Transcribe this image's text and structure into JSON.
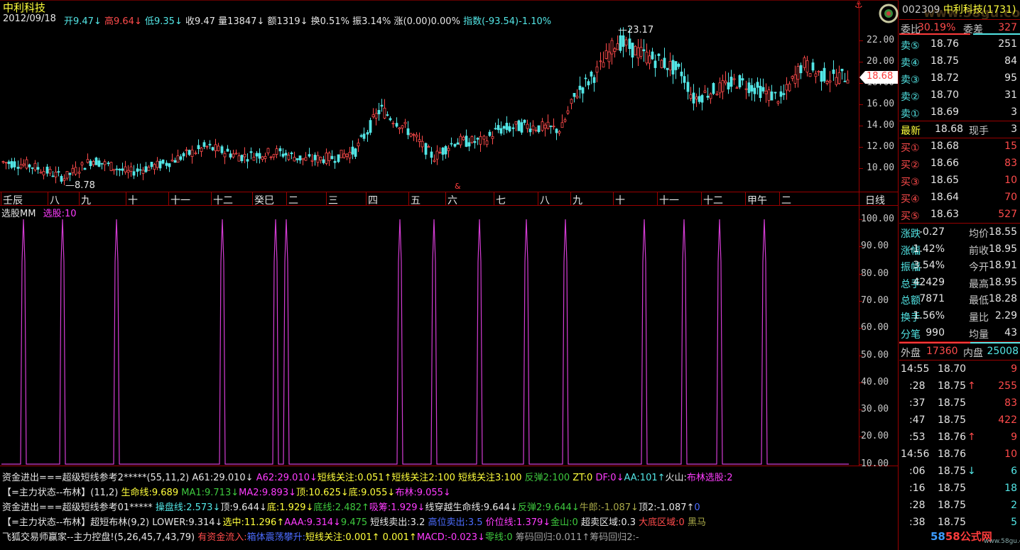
{
  "header": {
    "stock_name": "中利科技",
    "date": "2012/09/18",
    "items": [
      {
        "text": "开9.47",
        "color": "#53e6e6",
        "arrow": "↓",
        "arrow_color": "#53e6e6"
      },
      {
        "text": "高9.64",
        "color": "#ff4b4b",
        "arrow": "↓",
        "arrow_color": "#ff4b4b"
      },
      {
        "text": "低9.35",
        "color": "#53e6e6",
        "arrow": "↓",
        "arrow_color": "#53e6e6"
      },
      {
        "text": "收9.47",
        "color": "#e6e6e6",
        "arrow": "",
        "arrow_color": ""
      },
      {
        "text": "量13847",
        "color": "#e6e6e6",
        "arrow": "↓",
        "arrow_color": "#e6e6e6"
      },
      {
        "text": "额1319",
        "color": "#e6e6e6",
        "arrow": "↓",
        "arrow_color": "#e6e6e6"
      },
      {
        "text": "换0.51%",
        "color": "#e6e6e6",
        "arrow": "",
        "arrow_color": ""
      },
      {
        "text": "振3.14%",
        "color": "#e6e6e6",
        "arrow": "",
        "arrow_color": ""
      },
      {
        "text": "涨(0.00)0.00%",
        "color": "#e6e6e6",
        "arrow": "",
        "arrow_color": ""
      },
      {
        "text": "指数(-93.54)-1.10%",
        "color": "#53e6e6",
        "arrow": "",
        "arrow_color": ""
      }
    ]
  },
  "kline": {
    "high_label": "23.17",
    "low_label": "8.78",
    "price_axis": [
      "22.00",
      "20.00",
      "18.00",
      "16.00",
      "14.00",
      "12.00",
      "10.00"
    ],
    "current_price": "18.68",
    "month_labels": [
      "壬辰",
      "八",
      "九",
      "十",
      "十一",
      "十二",
      "癸巳",
      "二",
      "三",
      "四",
      "五",
      "六",
      "七",
      "八",
      "九",
      "十",
      "十一",
      "十二",
      "甲午",
      "二"
    ],
    "period": "日线",
    "marker": "&"
  },
  "indicator": {
    "name": "选股MM",
    "value_label": "选股:10",
    "axis": [
      "100.00",
      "90.00",
      "80.00",
      "70.00",
      "60.00",
      "50.00",
      "40.00",
      "30.00",
      "20.00",
      "10.00"
    ]
  },
  "formula_lines": [
    [
      {
        "t": "资金进出===超级短线参考2*****(55,11,2)",
        "c": "#e6e6e6"
      },
      {
        "t": " A61:29.010",
        "c": "#e6e6e6"
      },
      {
        "t": "↓",
        "c": "#e6e6e6"
      },
      {
        "t": " A62:29.010",
        "c": "#ff3cff"
      },
      {
        "t": "↓",
        "c": "#ff3cff"
      },
      {
        "t": "短线关注:0.051",
        "c": "#ffff3c"
      },
      {
        "t": "↑",
        "c": "#ffff3c"
      },
      {
        "t": "短线关注2:100 ",
        "c": "#ffff3c"
      },
      {
        "t": "短线关注3:100 ",
        "c": "#ffff3c"
      },
      {
        "t": "反弹2:100 ",
        "c": "#3ec93e"
      },
      {
        "t": "ZT:0 ",
        "c": "#ffff3c"
      },
      {
        "t": "DF:0",
        "c": "#ff3cff"
      },
      {
        "t": "↓",
        "c": "#ff3cff"
      },
      {
        "t": "AA:101",
        "c": "#53e6e6"
      },
      {
        "t": "↑",
        "c": "#53e6e6"
      },
      {
        "t": "火山:",
        "c": "#e6e6e6"
      },
      {
        "t": "布林选股:2",
        "c": "#ff3cff"
      }
    ],
    [
      {
        "t": "【=主力状态--布林】(11,2) ",
        "c": "#e6e6e6"
      },
      {
        "t": "生命线:9.689 ",
        "c": "#ffff3c"
      },
      {
        "t": "MA1:9.713",
        "c": "#3ec93e"
      },
      {
        "t": "↓",
        "c": "#3ec93e"
      },
      {
        "t": "MA2:9.893",
        "c": "#ff3cff"
      },
      {
        "t": "↓",
        "c": "#ff3cff"
      },
      {
        "t": "顶:10.625",
        "c": "#ffff3c"
      },
      {
        "t": "↓",
        "c": "#ffff3c"
      },
      {
        "t": "底:9.055",
        "c": "#ffff3c"
      },
      {
        "t": "↓",
        "c": "#ffff3c"
      },
      {
        "t": "布林:9.055",
        "c": "#ff3cff"
      },
      {
        "t": "↓",
        "c": "#ff3cff"
      }
    ],
    [
      {
        "t": "资金进出===超级短线参考01***** ",
        "c": "#e6e6e6"
      },
      {
        "t": "操盘线:2.573",
        "c": "#53e6e6"
      },
      {
        "t": "↓",
        "c": "#53e6e6"
      },
      {
        "t": "顶:9.644",
        "c": "#e6e6e6"
      },
      {
        "t": "↓",
        "c": "#e6e6e6"
      },
      {
        "t": "底:1.929",
        "c": "#ffff3c"
      },
      {
        "t": "↓",
        "c": "#ffff3c"
      },
      {
        "t": "底线:2.482",
        "c": "#3ec93e"
      },
      {
        "t": "↑",
        "c": "#3ec93e"
      },
      {
        "t": "吸筹:1.929",
        "c": "#ff3cff"
      },
      {
        "t": "↓",
        "c": "#ff3cff"
      },
      {
        "t": "线穿越生命线:9.644",
        "c": "#e6e6e6"
      },
      {
        "t": "↓",
        "c": "#e6e6e6"
      },
      {
        "t": "反弹2:9.644",
        "c": "#3ec93e"
      },
      {
        "t": "↓",
        "c": "#3ec93e"
      },
      {
        "t": "牛郎:-1.087",
        "c": "#a8a848"
      },
      {
        "t": "↓",
        "c": "#a8a848"
      },
      {
        "t": "顶2:-1.087",
        "c": "#e6e6e6"
      },
      {
        "t": "↑",
        "c": "#e6e6e6"
      },
      {
        "t": "0",
        "c": "#4c6cff"
      }
    ],
    [
      {
        "t": "【=主力状态--布林】超短布林(9,2) LOWER:9.314",
        "c": "#e6e6e6"
      },
      {
        "t": "↓",
        "c": "#e6e6e6"
      },
      {
        "t": "选中:11.296",
        "c": "#ffff3c"
      },
      {
        "t": "↑",
        "c": "#ffff3c"
      },
      {
        "t": "AAA:9.314",
        "c": "#ff3cff"
      },
      {
        "t": "↓",
        "c": "#ff3cff"
      },
      {
        "t": "9.475 ",
        "c": "#3ec93e"
      },
      {
        "t": "短线卖出:3.2 ",
        "c": "#e6e6e6"
      },
      {
        "t": "高位卖出:3.5 ",
        "c": "#4c6cff"
      },
      {
        "t": "价位线:1.379",
        "c": "#ff3cff"
      },
      {
        "t": "↓",
        "c": "#ff3cff"
      },
      {
        "t": "金山:0 ",
        "c": "#3ec93e"
      },
      {
        "t": "超卖区域:0.3 ",
        "c": "#e6e6e6"
      },
      {
        "t": "大底区域:0 ",
        "c": "#ff4b4b"
      },
      {
        "t": "黑马",
        "c": "#a8a848"
      }
    ],
    [
      {
        "t": "飞狐交易师赢家--主力控盘!(5,26,45,7,43,79) ",
        "c": "#e6e6e6"
      },
      {
        "t": "有资金流入:",
        "c": "#ff4b4b"
      },
      {
        "t": "箱体震荡攀升:",
        "c": "#4c6cff"
      },
      {
        "t": "短线关注:0.001",
        "c": "#ffff3c"
      },
      {
        "t": "↑",
        "c": "#ffff3c"
      },
      {
        "t": " 0.001",
        "c": "#ffff3c"
      },
      {
        "t": "↑",
        "c": "#ffff3c"
      },
      {
        "t": "MACD:-0.023",
        "c": "#ff3cff"
      },
      {
        "t": "↓",
        "c": "#ff3cff"
      },
      {
        "t": "零线:0",
        "c": "#3ec93e"
      },
      {
        "t": "                    筹码回归:0.011",
        "c": "#a0a0a0"
      },
      {
        "t": "↑",
        "c": "#a0a0a0"
      },
      {
        "t": "筹码回归2:-",
        "c": "#a0a0a0"
      }
    ]
  ],
  "panel": {
    "code": "002309",
    "name": "中利科技",
    "code_suffix": "(1731)",
    "webi_label": "委比",
    "webi_value": "30.19%",
    "weicha_label": "委差",
    "weicha_value": "327",
    "sell": [
      {
        "label": "卖⑤",
        "price": "18.76",
        "vol": "251"
      },
      {
        "label": "卖④",
        "price": "18.75",
        "vol": "84"
      },
      {
        "label": "卖③",
        "price": "18.72",
        "vol": "95"
      },
      {
        "label": "卖②",
        "price": "18.70",
        "vol": "31"
      },
      {
        "label": "卖①",
        "price": "18.69",
        "vol": "3"
      }
    ],
    "latest_label": "最新",
    "latest_price": "18.68",
    "xianshou_label": "现手",
    "xianshou_value": "3",
    "buy": [
      {
        "label": "买①",
        "price": "18.68",
        "vol": "15"
      },
      {
        "label": "买②",
        "price": "18.66",
        "vol": "83"
      },
      {
        "label": "买③",
        "price": "18.65",
        "vol": "10"
      },
      {
        "label": "买④",
        "price": "18.64",
        "vol": "70"
      },
      {
        "label": "买⑤",
        "price": "18.63",
        "vol": "527"
      }
    ],
    "stats": [
      {
        "l1": "涨跌",
        "v1": "-0.27",
        "v1c": "#e6e6e6",
        "l2": "均价",
        "v2": "18.55",
        "v2c": "#e6e6e6"
      },
      {
        "l1": "涨幅",
        "v1": "-1.42%",
        "v1c": "#e6e6e6",
        "l2": "前收",
        "v2": "18.95",
        "v2c": "#e6e6e6"
      },
      {
        "l1": "振幅",
        "v1": "3.54%",
        "v1c": "#e6e6e6",
        "l2": "今开",
        "v2": "18.91",
        "v2c": "#e6e6e6"
      },
      {
        "l1": "总手",
        "v1": "42429",
        "v1c": "#e6e6e6",
        "l2": "最高",
        "v2": "18.95",
        "v2c": "#e6e6e6"
      },
      {
        "l1": "总额",
        "v1": "7871",
        "v1c": "#e6e6e6",
        "l2": "最低",
        "v2": "18.28",
        "v2c": "#e6e6e6"
      },
      {
        "l1": "换手",
        "v1": "1.56%",
        "v1c": "#e6e6e6",
        "l2": "量比",
        "v2": "2.29",
        "v2c": "#e6e6e6"
      },
      {
        "l1": "分笔",
        "v1": "990",
        "v1c": "#e6e6e6",
        "l2": "均量",
        "v2": "43",
        "v2c": "#e6e6e6"
      }
    ],
    "waipan_label": "外盘",
    "waipan_value": "17360",
    "neipan_label": "内盘",
    "neipan_value": "25008",
    "ticks": [
      {
        "time": "14:55",
        "price": "18.70",
        "arrow": "",
        "vol": "9",
        "vc": "#ff4b4b"
      },
      {
        "time": ":28",
        "price": "18.75",
        "arrow": "↑",
        "ac": "#ff4b4b",
        "vol": "255",
        "vc": "#ff4b4b"
      },
      {
        "time": ":37",
        "price": "18.75",
        "arrow": "",
        "vol": "83",
        "vc": "#ff4b4b"
      },
      {
        "time": ":47",
        "price": "18.75",
        "arrow": "",
        "vol": "422",
        "vc": "#ff4b4b"
      },
      {
        "time": ":53",
        "price": "18.76",
        "arrow": "↑",
        "ac": "#ff4b4b",
        "vol": "9",
        "vc": "#ff4b4b"
      },
      {
        "time": "14:56",
        "price": "18.76",
        "arrow": "",
        "vol": "10",
        "vc": "#ff4b4b"
      },
      {
        "time": ":06",
        "price": "18.75",
        "arrow": "↓",
        "ac": "#53e6e6",
        "vol": "6",
        "vc": "#53e6e6"
      },
      {
        "time": ":16",
        "price": "18.75",
        "arrow": "",
        "vol": "18",
        "vc": "#53e6e6"
      },
      {
        "time": ":28",
        "price": "18.75",
        "arrow": "",
        "vol": "2",
        "vc": "#53e6e6"
      },
      {
        "time": ":38",
        "price": "18.75",
        "arrow": "",
        "vol": "5",
        "vc": "#53e6e6"
      }
    ],
    "watermark_top": "www.58gu.com",
    "watermark_bottom": "58公式网",
    "watermark_url": "www.58gu.com"
  },
  "colors": {
    "up": "#ff4b4b",
    "down": "#53e6e6",
    "grid": "#9a0000",
    "indicator_line": "#d43cd4"
  }
}
